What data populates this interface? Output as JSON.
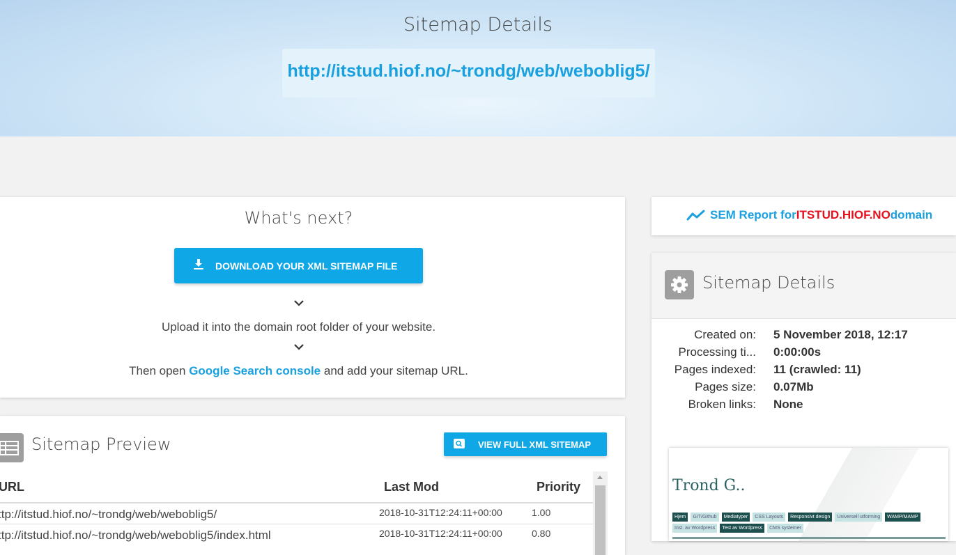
{
  "hero": {
    "title": "Sitemap Details",
    "url": "http://itstud.hiof.no/~trondg/web/weboblig5/"
  },
  "next": {
    "title": "What's next?",
    "download_label": "Download your XML sitemap file",
    "step1": "Upload it into the domain root folder of your website.",
    "step2_prefix": "Then open ",
    "step2_link": "Google Search console",
    "step2_suffix": " and add your sitemap URL."
  },
  "preview": {
    "title": "Sitemap Preview",
    "view_label": "View full XML sitemap",
    "columns": [
      "URL",
      "Last Mod",
      "Priority"
    ],
    "rows": [
      {
        "url": "ttp://itstud.hiof.no/~trondg/web/weboblig5/",
        "mod": "2018-10-31T12:24:11+00:00",
        "priority": "1.00"
      },
      {
        "url": "ttp://itstud.hiof.no/~trondg/web/weboblig5/index.html",
        "mod": "2018-10-31T12:24:11+00:00",
        "priority": "0.80"
      }
    ]
  },
  "sem": {
    "prefix": "SEM Report for ",
    "domain": "ITSTUD.HIOF.NO",
    "suffix": " domain"
  },
  "details": {
    "title": "Sitemap Details",
    "items": [
      {
        "label": "Created on:",
        "value": "5 November 2018, 12:17"
      },
      {
        "label": "Processing ti...",
        "value": "0:00:00s"
      },
      {
        "label": "Pages indexed:",
        "value": "11 (crawled: 11)"
      },
      {
        "label": "Pages size:",
        "value": "0.07Mb"
      },
      {
        "label": "Broken links:",
        "value": "None"
      }
    ]
  },
  "thumbnail": {
    "name": "Trond G..",
    "nav": [
      "Hjem",
      "GIT/Github",
      "Mediatyper",
      "CSS Layouts",
      "Responsivt design",
      "Universell utforming",
      "WAMP/MAMP",
      "Inst. av Wordpress",
      "Test av Wordpress",
      "CMS systemer"
    ]
  },
  "colors": {
    "accent": "#0fa7e6",
    "link": "#1aa0de",
    "domain_highlight": "#e5111f"
  }
}
